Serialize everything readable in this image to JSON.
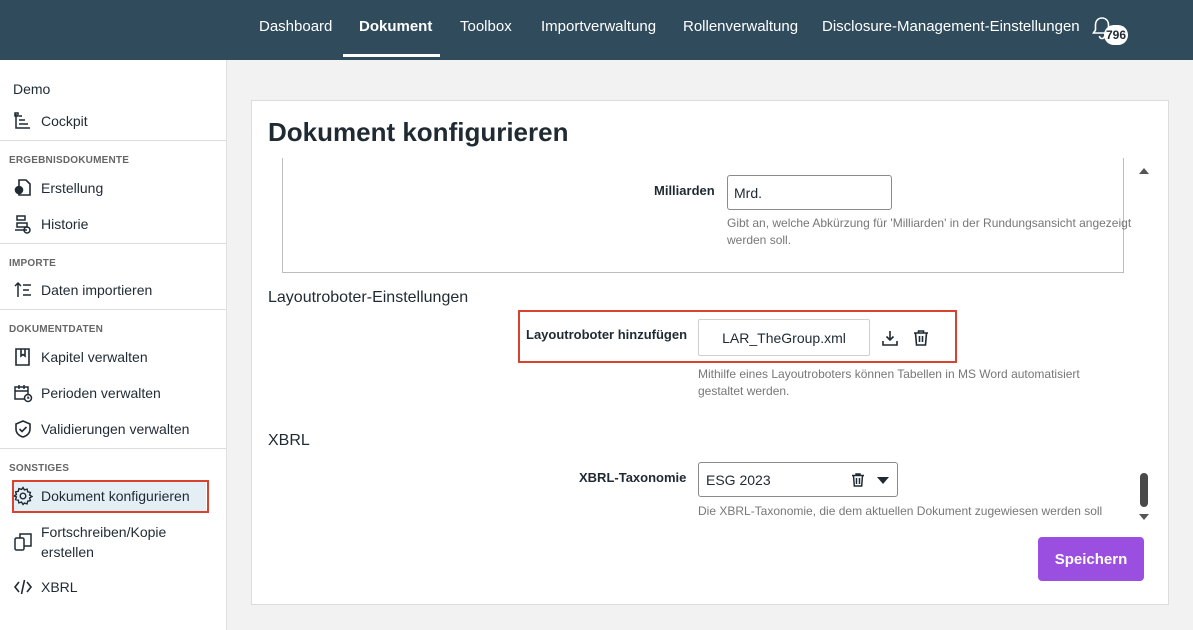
{
  "nav": {
    "items": [
      "Dashboard",
      "Dokument",
      "Toolbox",
      "Importverwaltung",
      "Rollenverwaltung",
      "Disclosure-Management-Einstellungen"
    ],
    "active": "Dokument",
    "notification_count": "796"
  },
  "sidebar": {
    "org": "Demo",
    "cockpit": "Cockpit",
    "sections": {
      "ergebnis": "ERGEBNISDOKUMENTE",
      "importe": "IMPORTE",
      "dokumentdaten": "DOKUMENTDATEN",
      "sonstiges": "SONSTIGES"
    },
    "items": {
      "erstellung": "Erstellung",
      "historie": "Historie",
      "daten_importieren": "Daten importieren",
      "kapitel": "Kapitel verwalten",
      "perioden": "Perioden verwalten",
      "validierungen": "Validierungen verwalten",
      "dokument_konfigurieren": "Dokument konfigurieren",
      "fortschreiben_1": "Fortschreiben/Kopie",
      "fortschreiben_2": "erstellen",
      "xbrl": "XBRL"
    }
  },
  "main": {
    "title": "Dokument konfigurieren",
    "milliarden": {
      "label": "Milliarden",
      "value": "Mrd.",
      "hint_1": "Gibt an, welche Abkürzung für 'Milliarden' in der Rundungsansicht angezeigt",
      "hint_2": "werden soll."
    },
    "layoutroboter": {
      "section": "Layoutroboter-Einstellungen",
      "label": "Layoutroboter hinzufügen",
      "file": "LAR_TheGroup.xml",
      "hint_1": "Mithilfe eines Layoutroboters können Tabellen in MS Word automatisiert",
      "hint_2": "gestaltet werden."
    },
    "xbrl": {
      "section": "XBRL",
      "label": "XBRL-Taxonomie",
      "value": "ESG 2023",
      "hint": "Die XBRL-Taxonomie, die dem aktuellen Dokument zugewiesen werden soll"
    },
    "save_label": "Speichern"
  },
  "colors": {
    "topbar": "#2f4b5c",
    "accent": "#9b4fe0",
    "highlight": "#d9422f"
  }
}
